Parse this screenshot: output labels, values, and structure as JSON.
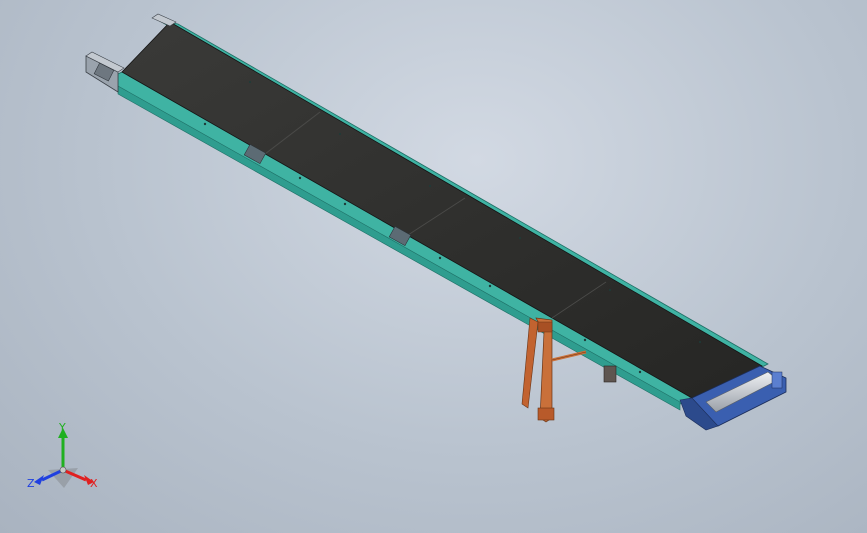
{
  "viewport": {
    "background_top": "#d2d9e3",
    "background_bottom": "#a9b3c0"
  },
  "model": {
    "belt_color": "#2f2f2d",
    "frame_color": "#3fb3a3",
    "frame_edge_color": "#1e6f66",
    "leg_color": "#c9703a",
    "end_plate_color": "#3a5fb0",
    "roller_color": "#c8ccd2"
  },
  "triad": {
    "x_label": "X",
    "y_label": "Y",
    "z_label": "Z",
    "x_color": "#e02020",
    "y_color": "#20b020",
    "z_color": "#2040e0"
  }
}
